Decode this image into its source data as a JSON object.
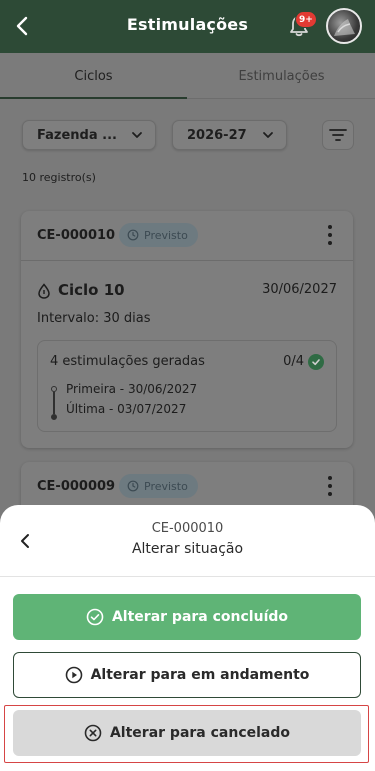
{
  "header": {
    "title": "Estimulações",
    "notifications_badge": "9+",
    "icons": [
      "back-arrow",
      "bell",
      "avatar"
    ]
  },
  "tabs": [
    {
      "label": "Ciclos",
      "active": true
    },
    {
      "label": "Estimulações",
      "active": false
    }
  ],
  "filters": {
    "farm": "Fazenda ...",
    "year": "2026-27"
  },
  "records_count": "10 registro(s)",
  "cards": [
    {
      "code": "CE-000010",
      "status": "Previsto",
      "cycle_title": "Ciclo 10",
      "cycle_date": "30/06/2027",
      "interval": "Intervalo: 30 dias",
      "generated_text": "4 estimulações geradas",
      "generated_count": "0/4",
      "first": "Primeira - 30/06/2027",
      "last": "Última - 03/07/2027"
    },
    {
      "code": "CE-000009",
      "status": "Previsto"
    }
  ],
  "sheet": {
    "code": "CE-000010",
    "title": "Alterar situação",
    "actions": {
      "concluido": "Alterar para concluído",
      "andamento": "Alterar para em andamento",
      "cancelado": "Alterar para cancelado"
    }
  },
  "colors": {
    "header_bg": "#2d4a36",
    "primary_green": "#5fb476",
    "badge_red": "#e23a33",
    "highlight_red": "#d64545"
  }
}
